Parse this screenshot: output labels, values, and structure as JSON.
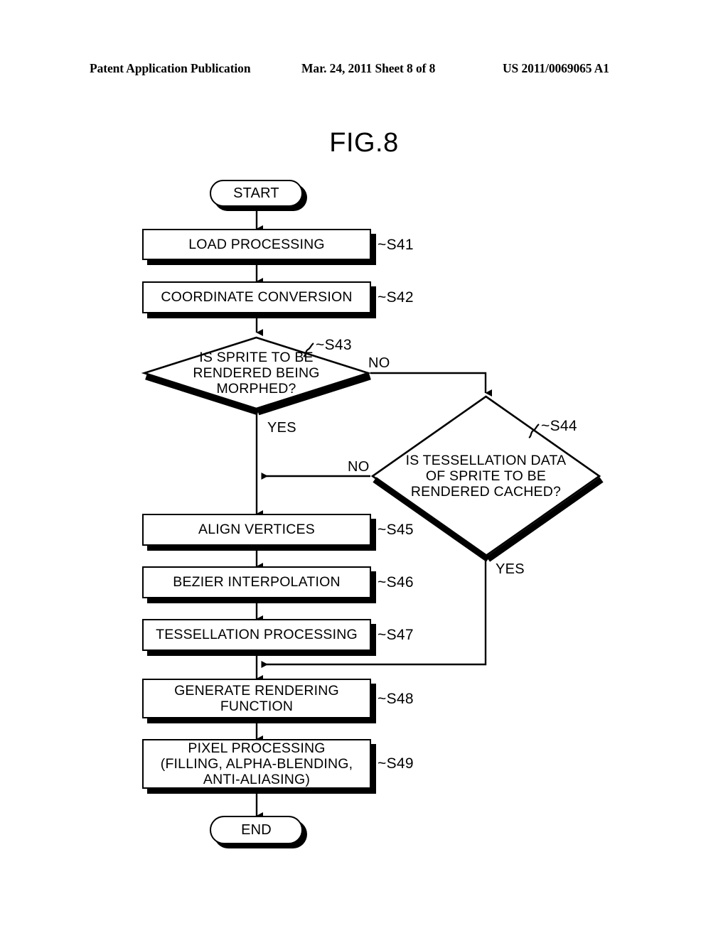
{
  "header": {
    "left": "Patent Application Publication",
    "center": "Mar. 24, 2011  Sheet 8 of 8",
    "right": "US 2011/0069065 A1"
  },
  "figure": {
    "title": "FIG.8"
  },
  "nodes": {
    "start": {
      "label": "START"
    },
    "s41": {
      "label": "LOAD PROCESSING",
      "ref": "~S41"
    },
    "s42": {
      "label": "COORDINATE CONVERSION",
      "ref": "~S42"
    },
    "s43": {
      "line1": "IS SPRITE TO BE",
      "line2": "RENDERED BEING",
      "line3": "MORPHED?",
      "ref": "~S43"
    },
    "s44": {
      "line1": "IS TESSELLATION DATA",
      "line2": "OF SPRITE TO BE",
      "line3": "RENDERED CACHED?",
      "ref": "~S44"
    },
    "s45": {
      "label": "ALIGN VERTICES",
      "ref": "~S45"
    },
    "s46": {
      "label": "BEZIER INTERPOLATION",
      "ref": "~S46"
    },
    "s47": {
      "label": "TESSELLATION PROCESSING",
      "ref": "~S47"
    },
    "s48": {
      "line1": "GENERATE RENDERING",
      "line2": "FUNCTION",
      "ref": "~S48"
    },
    "s49": {
      "line1": "PIXEL PROCESSING",
      "line2": "(FILLING, ALPHA-BLENDING,",
      "line3": "ANTI-ALIASING)",
      "ref": "~S49"
    },
    "end": {
      "label": "END"
    }
  },
  "branches": {
    "s43_no": "NO",
    "s43_yes": "YES",
    "s44_no": "NO",
    "s44_yes": "YES"
  },
  "colors": {
    "ink": "#000000",
    "paper": "#ffffff"
  }
}
